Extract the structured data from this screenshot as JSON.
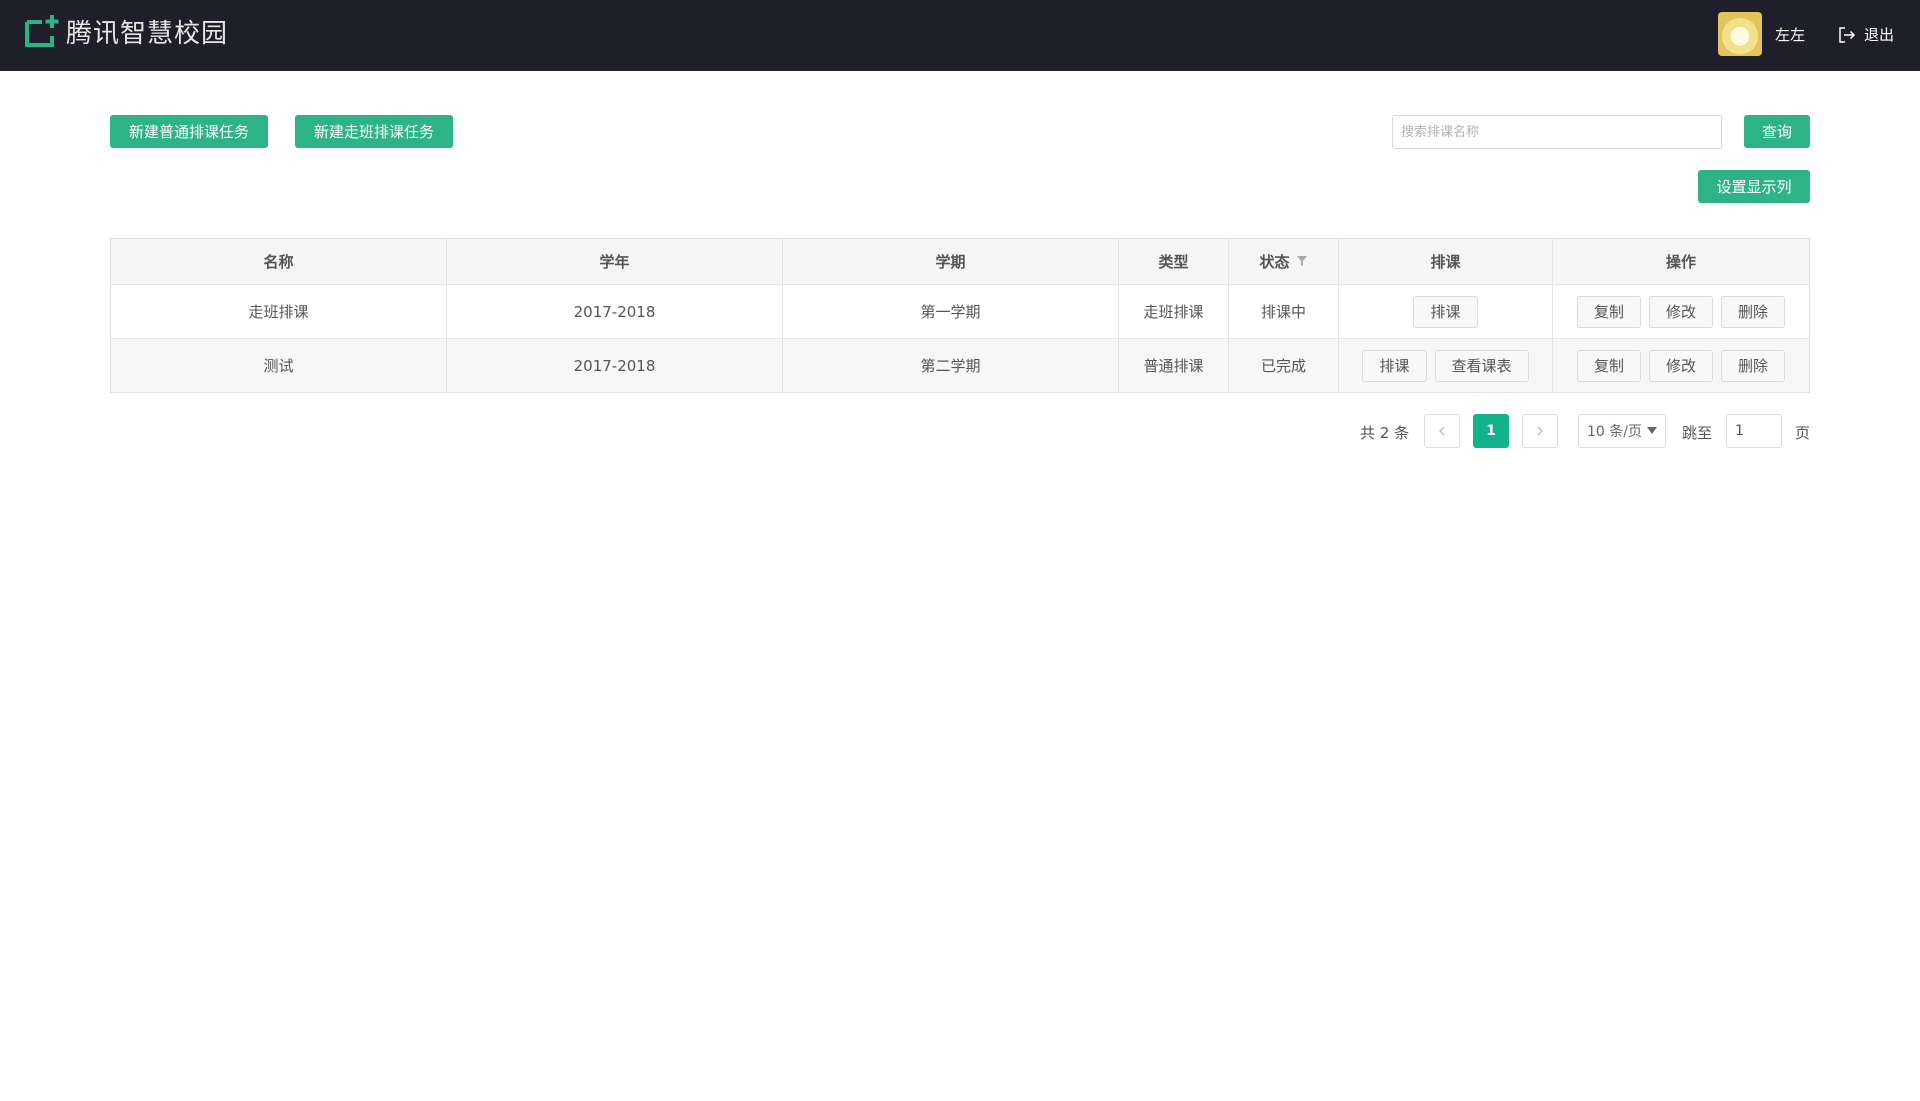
{
  "header": {
    "brand": "腾讯智慧校园",
    "username": "左左",
    "logout_label": "退出",
    "bg_color": "#1f1f2b",
    "accent": "#2db386"
  },
  "toolbar": {
    "new_normal_label": "新建普通排课任务",
    "new_walk_label": "新建走班排课任务",
    "search_placeholder": "搜索排课名称",
    "query_label": "查询",
    "set_columns_label": "设置显示列"
  },
  "table": {
    "headers": [
      "名称",
      "学年",
      "学期",
      "类型",
      "状态",
      "排课",
      "操作"
    ],
    "rows": [
      {
        "name": "走班排课",
        "year": "2017-2018",
        "term": "第一学期",
        "type": "走班排课",
        "status": "排课中",
        "schedule_actions": [
          "排课"
        ],
        "ops": [
          "复制",
          "修改",
          "删除"
        ]
      },
      {
        "name": "测试",
        "year": "2017-2018",
        "term": "第二学期",
        "type": "普通排课",
        "status": "已完成",
        "schedule_actions": [
          "排课",
          "查看课表"
        ],
        "ops": [
          "复制",
          "修改",
          "删除"
        ]
      }
    ]
  },
  "pagination": {
    "total_text": "共 2 条",
    "current_page": "1",
    "page_size": "10 条/页",
    "jump_label": "跳至",
    "jump_value": "1",
    "page_suffix": "页"
  }
}
